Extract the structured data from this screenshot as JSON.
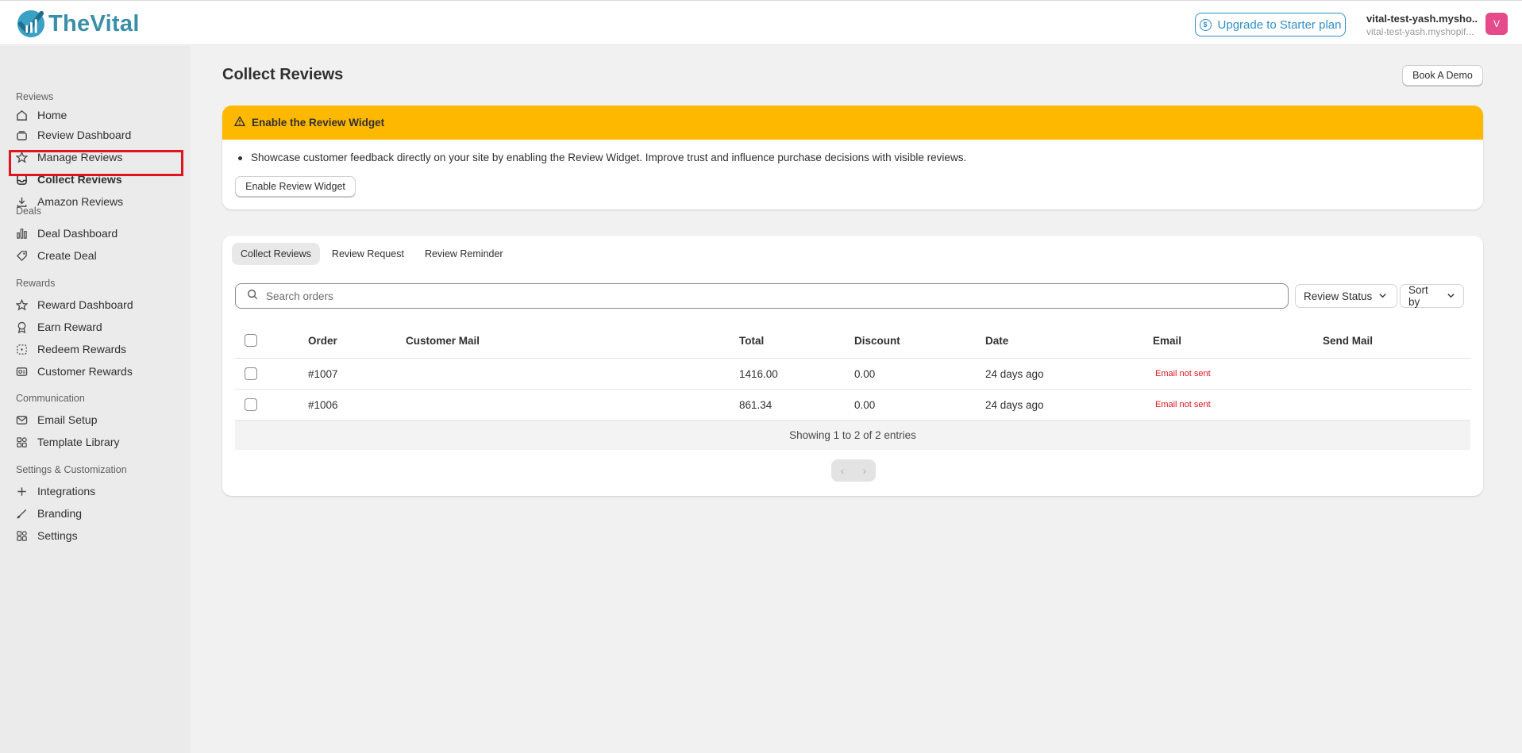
{
  "app": {
    "name": "TheVital"
  },
  "header": {
    "upgrade_label": "Upgrade to Starter plan",
    "store_name": "vital-test-yash.mysho...",
    "store_domain": "vital-test-yash.myshopif...",
    "avatar_initial": "V"
  },
  "sidebar": {
    "home": "Home",
    "sections": {
      "reviews": "Reviews",
      "deals": "Deals",
      "rewards": "Rewards",
      "communication": "Communication",
      "settings": "Settings & Customization"
    },
    "items": {
      "review_dashboard": "Review Dashboard",
      "manage_reviews": "Manage Reviews",
      "collect_reviews": "Collect Reviews",
      "amazon_reviews": "Amazon Reviews",
      "deal_dashboard": "Deal Dashboard",
      "create_deal": "Create Deal",
      "reward_dashboard": "Reward Dashboard",
      "earn_reward": "Earn Reward",
      "redeem_rewards": "Redeem Rewards",
      "customer_rewards": "Customer Rewards",
      "email_setup": "Email Setup",
      "template_library": "Template Library",
      "integrations": "Integrations",
      "branding": "Branding",
      "settings": "Settings"
    },
    "active": "collect_reviews"
  },
  "main": {
    "title": "Collect Reviews",
    "book_demo": "Book A Demo",
    "banner": {
      "title": "Enable the Review Widget",
      "text": "Showcase customer feedback directly on your site by enabling the Review Widget. Improve trust and influence purchase decisions with visible reviews.",
      "button": "Enable Review Widget"
    },
    "tabs": [
      "Collect Reviews",
      "Review Request",
      "Review Reminder"
    ],
    "search_placeholder": "Search orders",
    "filters": {
      "review_status": "Review Status",
      "sort_by": "Sort by"
    },
    "table": {
      "columns": [
        "Order",
        "Customer Mail",
        "Total",
        "Discount",
        "Date",
        "Email",
        "Send Mail"
      ],
      "rows": [
        {
          "order": "#1007",
          "customer_mail": "",
          "total": "1416.00",
          "discount": "0.00",
          "date": "24 days ago",
          "email": "Email not sent",
          "send_mail": ""
        },
        {
          "order": "#1006",
          "customer_mail": "",
          "total": "861.34",
          "discount": "0.00",
          "date": "24 days ago",
          "email": "Email not sent",
          "send_mail": ""
        }
      ],
      "footer": "Showing 1 to 2 of 2 entries"
    }
  },
  "colors": {
    "accent": "#2f8fc4",
    "banner": "#ffb800",
    "error": "#e0141e",
    "highlight": "#e0141e"
  }
}
